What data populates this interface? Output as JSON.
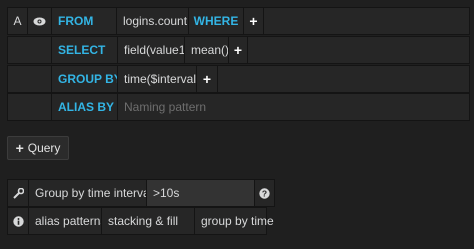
{
  "query": {
    "ref_id": "A",
    "eye_icon": "eye-icon",
    "from_label": "FROM",
    "from_value": "logins.count",
    "where_label": "WHERE",
    "select_label": "SELECT",
    "select_field": "field(value1)",
    "select_agg": "mean()",
    "group_by_label": "GROUP BY",
    "group_by_value": "time($interval)",
    "alias_by_label": "ALIAS BY",
    "alias_placeholder": "Naming pattern",
    "add_symbol": "+"
  },
  "query_button": {
    "icon": "plus-icon",
    "label": "Query"
  },
  "options": {
    "wrench_icon": "wrench-icon",
    "group_by_time_label": "Group by time interval",
    "group_by_time_value": ">10s",
    "help_icon": "question-icon",
    "info_icon": "info-icon",
    "alias_patterns": "alias patterns",
    "stacking_fill": "stacking & fill",
    "group_by_time": "group by time"
  },
  "colors": {
    "keyword": "#33b5e5",
    "background": "#1f1f1f",
    "segment": "#262626"
  }
}
